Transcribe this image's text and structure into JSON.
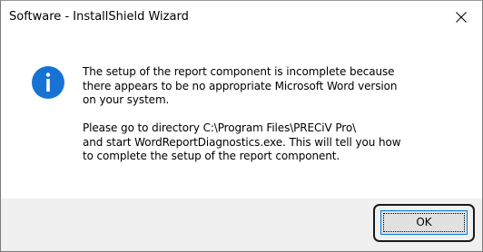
{
  "window": {
    "title": "Software - InstallShield Wizard",
    "close_glyph": "✕"
  },
  "message": {
    "icon": "info-icon",
    "paragraph1": [
      "The setup of the report component is incomplete because",
      "there appears to be no appropriate Microsoft Word version",
      "on your system."
    ],
    "paragraph2": [
      "Please go to directory C:\\Program Files\\PRECiV Pro\\",
      "and start WordReportDiagnostics.exe. This will tell you how",
      "to complete the setup of the report component."
    ]
  },
  "buttons": {
    "ok_label": "OK"
  },
  "colors": {
    "info_icon_blue": "#1773d3",
    "footer_bg": "#f0f0f0",
    "button_focus_border": "#0078d7"
  }
}
